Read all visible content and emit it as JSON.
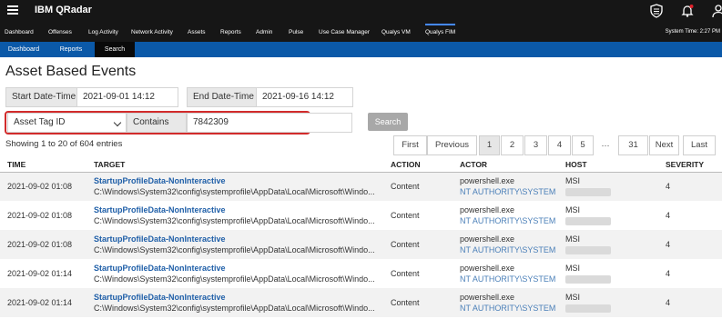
{
  "app": {
    "title": "IBM QRadar"
  },
  "nav": {
    "items": [
      "Dashboard",
      "Offenses",
      "Log Activity",
      "Network Activity",
      "Assets",
      "Reports",
      "Admin",
      "Pulse",
      "Use Case Manager",
      "Qualys VM",
      "Qualys FIM"
    ],
    "system_time": "System Time: 2:27 PM"
  },
  "subnav": {
    "items": [
      "Dashboard",
      "Reports",
      "Search"
    ],
    "active": "Search"
  },
  "page": {
    "title": "Asset Based Events"
  },
  "filters": {
    "start_label": "Start Date-Time",
    "start_value": "2021-09-01 14:12",
    "end_label": "End Date-Time",
    "end_value": "2021-09-16 14:12",
    "field_select": "Asset Tag ID",
    "operator": "Contains",
    "value": "7842309",
    "search_label": "Search"
  },
  "entries_info": "Showing 1 to 20 of 604 entries",
  "pagination": {
    "first": "First",
    "previous": "Previous",
    "pages": [
      "1",
      "2",
      "3",
      "4",
      "5"
    ],
    "ellipsis": "…",
    "last_page": "31",
    "next": "Next",
    "last": "Last",
    "current": "1"
  },
  "table": {
    "columns": [
      "TIME",
      "TARGET",
      "ACTION",
      "ACTOR",
      "HOST",
      "SEVERITY"
    ],
    "rows": [
      {
        "time": "2021-09-02 01:08",
        "target_title": "StartupProfileData-NonInteractive",
        "target_path": "C:\\Windows\\System32\\config\\systemprofile\\AppData\\Local\\Microsoft\\Windo...",
        "action": "Content",
        "actor_proc": "powershell.exe",
        "actor_user": "NT AUTHORITY\\SYSTEM",
        "host": "MSI",
        "severity": "4"
      },
      {
        "time": "2021-09-02 01:08",
        "target_title": "StartupProfileData-NonInteractive",
        "target_path": "C:\\Windows\\System32\\config\\systemprofile\\AppData\\Local\\Microsoft\\Windo...",
        "action": "Content",
        "actor_proc": "powershell.exe",
        "actor_user": "NT AUTHORITY\\SYSTEM",
        "host": "MSI",
        "severity": "4"
      },
      {
        "time": "2021-09-02 01:08",
        "target_title": "StartupProfileData-NonInteractive",
        "target_path": "C:\\Windows\\System32\\config\\systemprofile\\AppData\\Local\\Microsoft\\Windo...",
        "action": "Content",
        "actor_proc": "powershell.exe",
        "actor_user": "NT AUTHORITY\\SYSTEM",
        "host": "MSI",
        "severity": "4"
      },
      {
        "time": "2021-09-02 01:14",
        "target_title": "StartupProfileData-NonInteractive",
        "target_path": "C:\\Windows\\System32\\config\\systemprofile\\AppData\\Local\\Microsoft\\Windo...",
        "action": "Content",
        "actor_proc": "powershell.exe",
        "actor_user": "NT AUTHORITY\\SYSTEM",
        "host": "MSI",
        "severity": "4"
      },
      {
        "time": "2021-09-02 01:14",
        "target_title": "StartupProfileData-NonInteractive",
        "target_path": "C:\\Windows\\System32\\config\\systemprofile\\AppData\\Local\\Microsoft\\Windo...",
        "action": "Content",
        "actor_proc": "powershell.exe",
        "actor_user": "NT AUTHORITY\\SYSTEM",
        "host": "MSI",
        "severity": "4"
      }
    ]
  },
  "icons": [
    "menu-icon",
    "shield-icon",
    "bell-icon",
    "user-icon"
  ],
  "colors": {
    "nav_bg": "#161616",
    "subnav_bg": "#0b59a8",
    "link": "#1f5fa8",
    "highlight": "#d22b2b"
  }
}
